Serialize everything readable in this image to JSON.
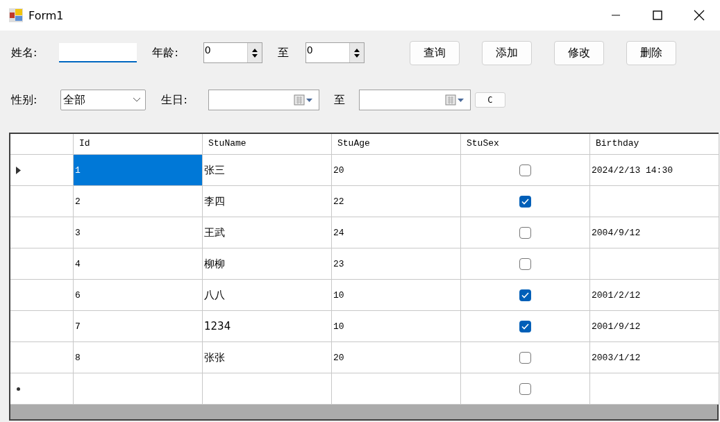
{
  "window": {
    "title": "Form1"
  },
  "filters": {
    "name_label": "姓名:",
    "age_label": "年龄:",
    "age_from": "0",
    "age_to_label": "至",
    "age_to": "0",
    "gender_label": "性别:",
    "gender_value": "全部",
    "birthday_label": "生日:",
    "birthday_to_label": "至",
    "clear_button": "C"
  },
  "buttons": [
    "查询",
    "添加",
    "修改",
    "删除"
  ],
  "table": {
    "columns": [
      "Id",
      "StuName",
      "StuAge",
      "StuSex",
      "Birthday"
    ],
    "rows": [
      {
        "id": "1",
        "name": "张三",
        "age": "20",
        "checked": false,
        "birthday": "2024/2/13 14:30",
        "selected": true
      },
      {
        "id": "2",
        "name": "李四",
        "age": "22",
        "checked": true,
        "selected": false
      },
      {
        "id": "3",
        "name": "王武",
        "age": "24",
        "checked": false,
        "birthday": "2004/9/12",
        "selected": false
      },
      {
        "id": "4",
        "name": "柳柳",
        "age": "23",
        "checked": false,
        "selected": false
      },
      {
        "id": "6",
        "name": "八八",
        "age": "10",
        "checked": true,
        "birthday": "2001/2/12",
        "selected": false
      },
      {
        "id": "7",
        "name": "1234",
        "age": "10",
        "checked": true,
        "birthday": "2001/9/12",
        "selected": false
      },
      {
        "id": "8",
        "name": "张张",
        "age": "20",
        "checked": false,
        "birthday": "2003/1/12",
        "selected": false
      }
    ],
    "new_row": {
      "checked": false
    }
  }
}
